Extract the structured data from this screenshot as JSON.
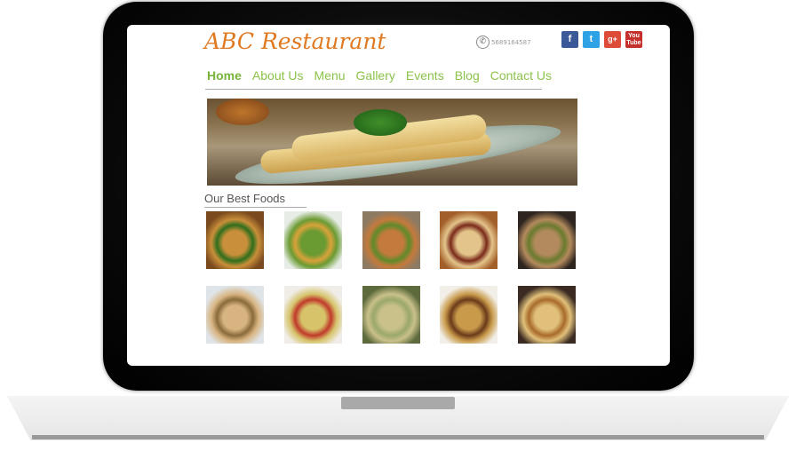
{
  "site": {
    "logo": "ABC Restaurant",
    "phone": "5689164587"
  },
  "socials": [
    {
      "name": "facebook",
      "glyph": "f",
      "color": "#3b5998"
    },
    {
      "name": "twitter",
      "glyph": "t",
      "color": "#2fa2e6"
    },
    {
      "name": "google-plus",
      "glyph": "g+",
      "color": "#dd4b39"
    },
    {
      "name": "youtube",
      "glyph": "You Tube",
      "color": "#c4302b"
    }
  ],
  "nav": {
    "items": [
      "Home",
      "About Us",
      "Menu",
      "Gallery",
      "Events",
      "Blog",
      "Contact Us"
    ],
    "active": "Home"
  },
  "best_foods": {
    "title": "Our Best Foods",
    "items": [
      {
        "name": "noodles-bowl",
        "colors": [
          "#7a4a1e",
          "#c98f3a",
          "#2f6e1c"
        ]
      },
      {
        "name": "salad-plate",
        "colors": [
          "#e7ede6",
          "#6a9a32",
          "#d9a23a"
        ]
      },
      {
        "name": "rice-pan",
        "colors": [
          "#8d7a63",
          "#c47a3c",
          "#5e8a2a"
        ]
      },
      {
        "name": "tacos",
        "colors": [
          "#a35f2a",
          "#e3c48a",
          "#7a2a1a"
        ]
      },
      {
        "name": "sandwich",
        "colors": [
          "#2e2520",
          "#b38a5d",
          "#6a7a2e"
        ]
      },
      {
        "name": "wraps",
        "colors": [
          "#dfe4e8",
          "#d8b481",
          "#8a6a3a"
        ]
      },
      {
        "name": "pasta-plate",
        "colors": [
          "#f0ede8",
          "#d6c36a",
          "#c03a2a"
        ]
      },
      {
        "name": "stuffed-dish",
        "colors": [
          "#5c6a3c",
          "#c9c08a",
          "#9aa86a"
        ]
      },
      {
        "name": "sandwich-fries",
        "colors": [
          "#f2efe8",
          "#c89a4a",
          "#6a3a1a"
        ]
      },
      {
        "name": "samosa-platter",
        "colors": [
          "#3a2a22",
          "#e0c07a",
          "#a86a2a"
        ]
      }
    ]
  }
}
